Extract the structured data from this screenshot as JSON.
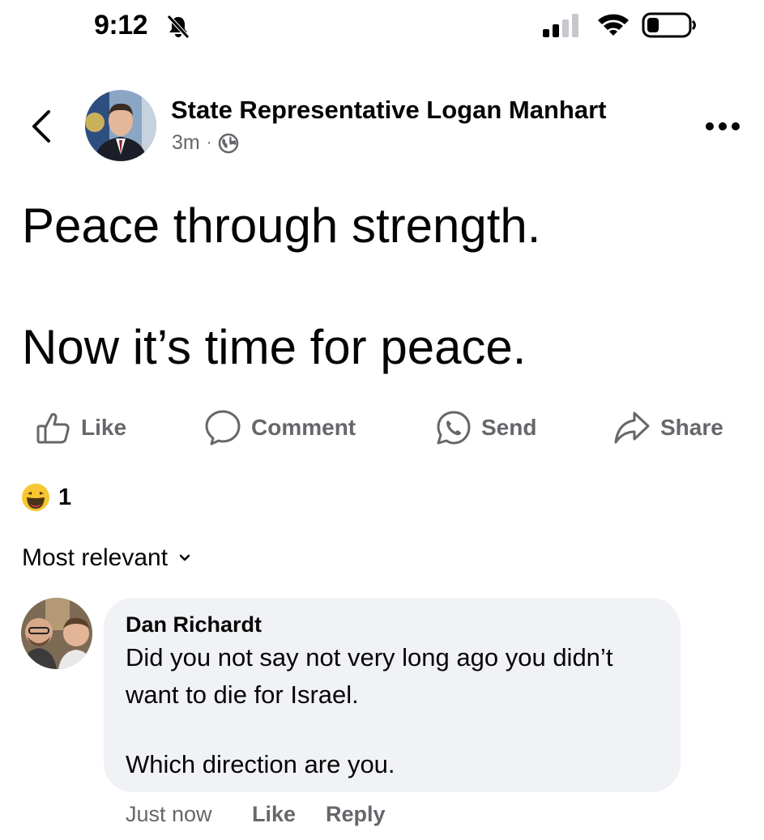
{
  "status_bar": {
    "time": "9:12",
    "icons": [
      "bell-muted-icon",
      "cellular-signal-icon",
      "wifi-icon",
      "battery-icon"
    ]
  },
  "post": {
    "author": "State Representative Logan Manhart",
    "timestamp": "3m",
    "separator": "·",
    "audience_icon": "globe-icon",
    "text_line1": "Peace through strength.",
    "text_line2": "Now it’s time for peace."
  },
  "actions": {
    "like": "Like",
    "comment": "Comment",
    "send": "Send",
    "share": "Share"
  },
  "reactions": {
    "icon": "haha-emoji-icon",
    "count": "1"
  },
  "sort": {
    "label": "Most relevant"
  },
  "comment": {
    "author": "Dan Richardt",
    "line1": "Did you not say not very long ago you didn’t",
    "line2": "want to die for Israel.",
    "line3": "Which direction are you.",
    "time": "Just now",
    "like": "Like",
    "reply": "Reply"
  },
  "colors": {
    "secondary_text": "#65676b",
    "primary_text": "#050505",
    "bubble_bg": "#f0f2f5",
    "emoji_yellow": "#f7c631"
  }
}
